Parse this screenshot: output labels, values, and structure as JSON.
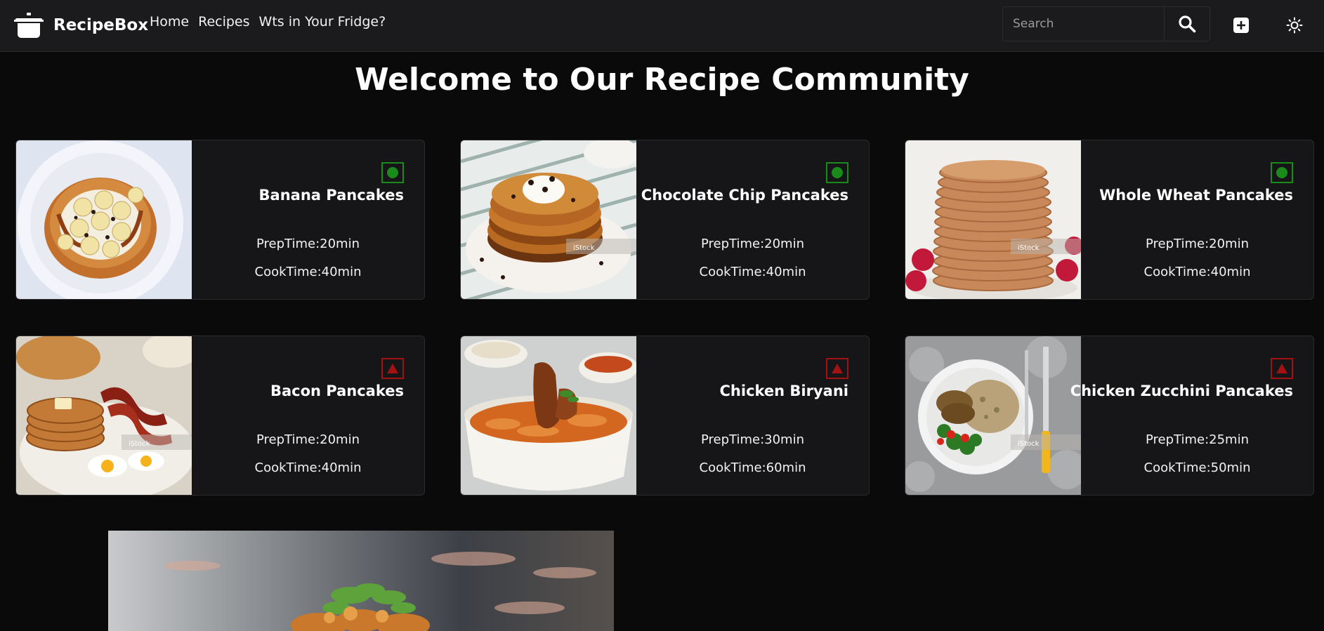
{
  "navbar": {
    "brand": "RecipeBox",
    "brand_icon": "cooking-pot-icon",
    "links": [
      "Home",
      "Recipes",
      "Wts in Your Fridge?"
    ],
    "search": {
      "placeholder": "Search",
      "value": ""
    },
    "search_icon": "search-icon",
    "add_icon": "plus-square-icon",
    "theme_icon": "sun-icon"
  },
  "page": {
    "title": "Welcome to Our Recipe Community"
  },
  "recipes": [
    {
      "name": "Banana Pancakes",
      "diet": "veg",
      "prep": "PrepTime:20min",
      "cook": "CookTime:40min"
    },
    {
      "name": "Chocolate Chip Pancakes",
      "diet": "veg",
      "prep": "PrepTime:20min",
      "cook": "CookTime:40min"
    },
    {
      "name": "Whole Wheat Pancakes",
      "diet": "veg",
      "prep": "PrepTime:20min",
      "cook": "CookTime:40min"
    },
    {
      "name": "Bacon Pancakes",
      "diet": "non-veg",
      "prep": "PrepTime:20min",
      "cook": "CookTime:40min"
    },
    {
      "name": "Chicken Biryani",
      "diet": "non-veg",
      "prep": "PrepTime:30min",
      "cook": "CookTime:60min"
    },
    {
      "name": "Chicken Zucchini Pancakes",
      "diet": "non-veg",
      "prep": "PrepTime:25min",
      "cook": "CookTime:50min"
    }
  ],
  "colors": {
    "background": "#0a0a0b",
    "navbar": "#1b1b1d",
    "card": "#161618",
    "veg": "#1a8a1a",
    "non_veg": "#a31212"
  }
}
